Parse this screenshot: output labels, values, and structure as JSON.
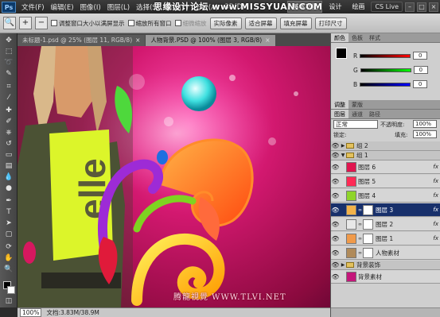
{
  "menubar": {
    "logo": "Ps",
    "items": [
      "文件(F)",
      "编辑(E)",
      "图像(I)",
      "图层(L)",
      "选择(S)",
      "滤镜(T)",
      "分析(A)",
      "3D(D)"
    ],
    "workspace_active": "基本功能",
    "workspace_items": [
      "设计",
      "绘画"
    ],
    "cslive": "CS Live",
    "window_buttons": [
      "–",
      "□",
      "×"
    ]
  },
  "watermark_top": "思缘设计论坛 www.MISSYUAN.COM",
  "options": {
    "check1": "调整窗口大小以满屏显示",
    "check2": "缩放所有窗口",
    "check3": "细微缩放",
    "buttons": [
      "实际像素",
      "适合屏幕",
      "填充屏幕",
      "打印尺寸"
    ]
  },
  "doctabs": [
    {
      "label": "未标题-1.psd @ 25% (图层 11, RGB/8)",
      "close": "×",
      "active": false
    },
    {
      "label": "人物背景.PSD @ 100% (图层 3, RGB/8)",
      "close": "×",
      "active": true
    }
  ],
  "canvas": {
    "watermark": "腾龍視覺 WWW.TLVI.NET"
  },
  "status": {
    "zoom": "100%",
    "doc": "文档:3.83M/38.9M"
  },
  "panels": {
    "color_tabs": [
      "颜色",
      "色板",
      "样式"
    ],
    "channels": [
      {
        "label": "R",
        "value": "0"
      },
      {
        "label": "G",
        "value": "0"
      },
      {
        "label": "B",
        "value": "0"
      }
    ],
    "adj_tabs": [
      "调整",
      "蒙版"
    ],
    "layer_tabs": [
      "图层",
      "通道",
      "路径"
    ],
    "blend_mode": "正常",
    "opacity_label": "不透明度:",
    "opacity_value": "100%",
    "lock_label": "锁定:",
    "fill_label": "填充:",
    "fill_value": "100%"
  },
  "layers": [
    {
      "name": "组 2",
      "type": "group"
    },
    {
      "name": "组 1",
      "type": "group"
    },
    {
      "name": "图层 6",
      "type": "layer",
      "fx": "fx"
    },
    {
      "name": "图层 5",
      "type": "layer",
      "fx": "fx"
    },
    {
      "name": "图层 4",
      "type": "layer",
      "fx": "fx"
    },
    {
      "name": "图层 3",
      "type": "layer",
      "fx": "fx",
      "selected": true
    },
    {
      "name": "图层 2",
      "type": "layer",
      "fx": "fx"
    },
    {
      "name": "图层 1",
      "type": "layer",
      "fx": "fx"
    },
    {
      "name": "人物素材",
      "type": "layer"
    },
    {
      "name": "背景装饰",
      "type": "group"
    },
    {
      "name": "背景素材",
      "type": "layer"
    }
  ],
  "colors": {
    "selection": "#18306b"
  }
}
